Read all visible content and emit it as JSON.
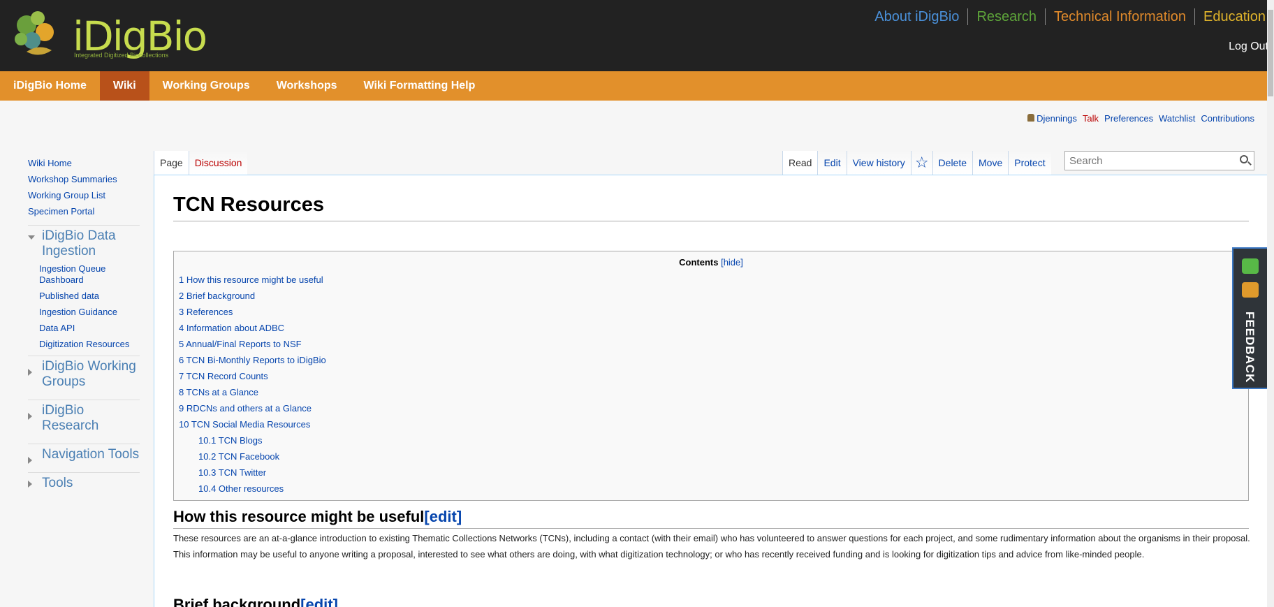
{
  "header": {
    "logo_text": "iDigBio",
    "logo_subtitle": "Integrated Digitized Biocollections",
    "top_nav": [
      {
        "label": "About iDigBio",
        "color": "#4a90d9"
      },
      {
        "label": "Research",
        "color": "#5ea53a"
      },
      {
        "label": "Technical Information",
        "color": "#e08a2b"
      },
      {
        "label": "Education",
        "color": "#e0b42b"
      }
    ],
    "logout_label": "Log Out"
  },
  "main_nav": {
    "items": [
      "iDigBio Home",
      "Wiki",
      "Working Groups",
      "Workshops",
      "Wiki Formatting Help"
    ],
    "active": "Wiki"
  },
  "user_links": {
    "username": "Djennings",
    "talk": "Talk",
    "preferences": "Preferences",
    "watchlist": "Watchlist",
    "contributions": "Contributions"
  },
  "sidebar": {
    "links": [
      "Wiki Home",
      "Workshop Summaries",
      "Working Group List",
      "Specimen Portal"
    ],
    "portals": [
      {
        "title": "iDigBio Data Ingestion",
        "expanded": true,
        "items": [
          "Ingestion Queue Dashboard",
          "Published data",
          "Ingestion Guidance",
          "Data API",
          "Digitization Resources"
        ]
      },
      {
        "title": "iDigBio Working Groups",
        "expanded": false
      },
      {
        "title": "iDigBio Research",
        "expanded": false
      },
      {
        "title": "Navigation Tools",
        "expanded": false
      },
      {
        "title": "Tools",
        "expanded": false
      }
    ]
  },
  "tabs": {
    "left": [
      "Page",
      "Discussion"
    ],
    "right": [
      "Read",
      "Edit",
      "View history",
      "Delete",
      "Move",
      "Protect"
    ]
  },
  "search": {
    "placeholder": "Search"
  },
  "page": {
    "title": "TCN Resources",
    "toc": {
      "title": "Contents",
      "hide_label": "[hide]",
      "items": [
        {
          "text": "1 How this resource might be useful",
          "level": 1
        },
        {
          "text": "2 Brief background",
          "level": 1
        },
        {
          "text": "3 References",
          "level": 1
        },
        {
          "text": "4 Information about ADBC",
          "level": 1
        },
        {
          "text": "5 Annual/Final Reports to NSF",
          "level": 1
        },
        {
          "text": "6 TCN Bi-Monthly Reports to iDigBio",
          "level": 1
        },
        {
          "text": "7 TCN Record Counts",
          "level": 1
        },
        {
          "text": "8 TCNs at a Glance",
          "level": 1
        },
        {
          "text": "9 RDCNs and others at a Glance",
          "level": 1
        },
        {
          "text": "10 TCN Social Media Resources",
          "level": 1
        },
        {
          "text": "10.1 TCN Blogs",
          "level": 2
        },
        {
          "text": "10.2 TCN Facebook",
          "level": 2
        },
        {
          "text": "10.3 TCN Twitter",
          "level": 2
        },
        {
          "text": "10.4 Other resources",
          "level": 2
        }
      ]
    },
    "section1": {
      "heading": "How this resource might be useful",
      "edit_label": "[edit]",
      "paragraph": "These resources are an at-a-glance introduction to existing Thematic Collections Networks (TCNs), including a contact (with their email) who has volunteered to answer questions for each project, and some rudimentary information about the organisms in their proposal. This information may be useful to anyone writing a proposal, interested to see what others are doing, with what digitization technology; or who has recently received funding and is looking for digitization tips and advice from like-minded people."
    },
    "section2": {
      "heading": "Brief background",
      "edit_label": "[edit]"
    }
  },
  "feedback": {
    "label": "FEEDBACK"
  },
  "colors": {
    "topbar": "#222222",
    "orange_nav": "#e2902b",
    "active_nav": "#b8511a",
    "link": "#0645ad",
    "redlink": "#ba0000"
  }
}
